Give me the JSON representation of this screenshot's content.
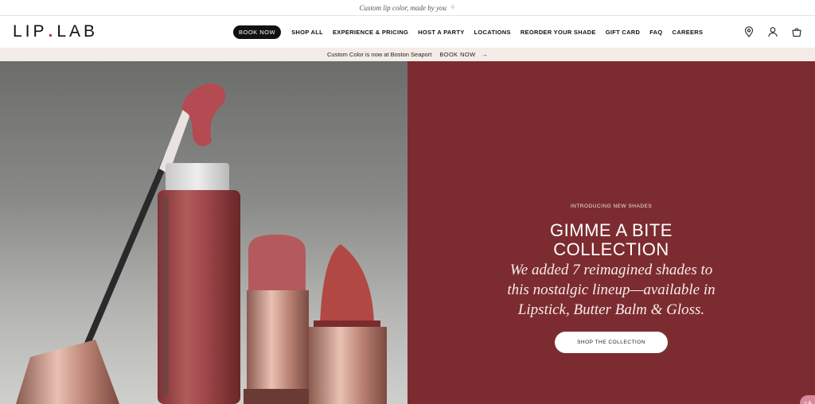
{
  "topbar": {
    "text": "Custom lip color, made by you",
    "icon": "sparkle-icon"
  },
  "header": {
    "logo": {
      "left": "LIP",
      "dot": ".",
      "right": "LAB"
    },
    "book_now": "BOOK NOW",
    "nav": [
      "SHOP ALL",
      "EXPERIENCE & PRICING",
      "HOST A PARTY",
      "LOCATIONS",
      "REORDER YOUR SHADE",
      "GIFT CARD",
      "FAQ",
      "CAREERS"
    ],
    "icons": [
      "location-pin-icon",
      "account-icon",
      "cart-bag-icon"
    ]
  },
  "announcement": {
    "text": "Custom Color is now at Boston Seaport",
    "cta": "BOOK NOW",
    "cta_icon": "→"
  },
  "hero": {
    "eyebrow": "INTRODUCING NEW SHADES",
    "title_line1": "GIMME A BITE",
    "title_line2": "COLLECTION",
    "subtitle": "We added 7 reimagined shades to this nostalgic lineup—available in Lipstick, Butter Balm & Gloss.",
    "button": "SHOP THE COLLECTION",
    "bg_color": "#7c2c30"
  },
  "accessibility_tab": "✧A"
}
